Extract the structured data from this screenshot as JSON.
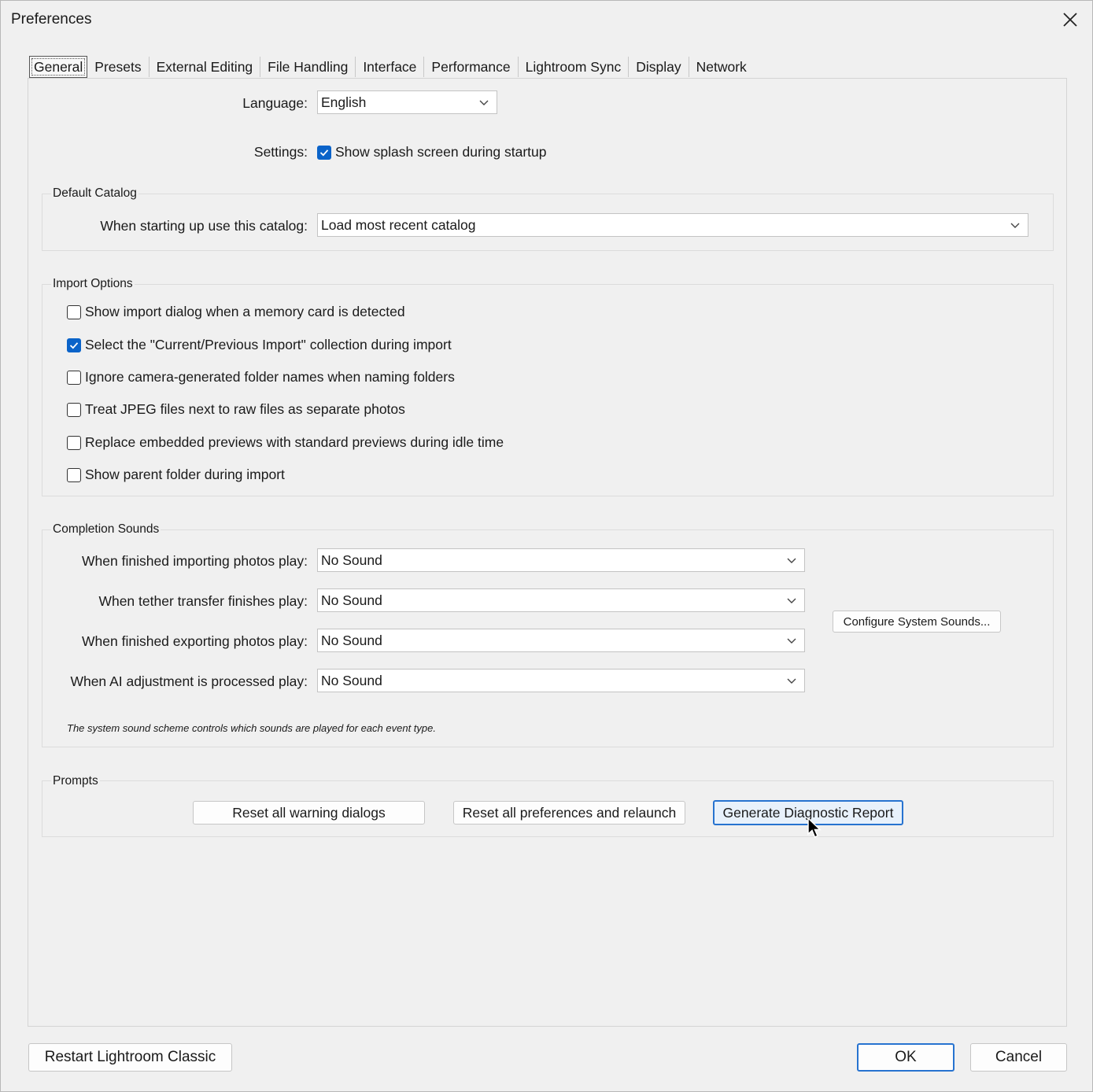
{
  "window": {
    "title": "Preferences"
  },
  "tabs": [
    {
      "label": "General",
      "active": true
    },
    {
      "label": "Presets"
    },
    {
      "label": "External Editing"
    },
    {
      "label": "File Handling"
    },
    {
      "label": "Interface"
    },
    {
      "label": "Performance"
    },
    {
      "label": "Lightroom Sync"
    },
    {
      "label": "Display"
    },
    {
      "label": "Network"
    }
  ],
  "general": {
    "language_label": "Language:",
    "language_value": "English",
    "settings_label": "Settings:",
    "splash": {
      "label": "Show splash screen during startup",
      "checked": true
    }
  },
  "default_catalog": {
    "title": "Default Catalog",
    "label": "When starting up use this catalog:",
    "value": "Load most recent catalog"
  },
  "import_options": {
    "title": "Import Options",
    "items": [
      {
        "label": "Show import dialog when a memory card is detected",
        "checked": false
      },
      {
        "label": "Select the \"Current/Previous Import\" collection during import",
        "checked": true
      },
      {
        "label": "Ignore camera-generated folder names when naming folders",
        "checked": false
      },
      {
        "label": "Treat JPEG files next to raw files as separate photos",
        "checked": false
      },
      {
        "label": "Replace embedded previews with standard previews during idle time",
        "checked": false
      },
      {
        "label": "Show parent folder during import",
        "checked": false
      }
    ]
  },
  "completion_sounds": {
    "title": "Completion Sounds",
    "rows": [
      {
        "label": "When finished importing photos play:",
        "value": "No Sound"
      },
      {
        "label": "When tether transfer finishes play:",
        "value": "No Sound"
      },
      {
        "label": "When finished exporting photos play:",
        "value": "No Sound"
      },
      {
        "label": "When AI adjustment is processed play:",
        "value": "No Sound"
      }
    ],
    "configure_button": "Configure System Sounds...",
    "note": "The system sound scheme controls which sounds are played for each event type."
  },
  "prompts": {
    "title": "Prompts",
    "reset_warnings": "Reset all warning dialogs",
    "reset_prefs": "Reset all preferences and relaunch",
    "diagnostic": "Generate Diagnostic Report"
  },
  "footer": {
    "restart": "Restart Lightroom Classic",
    "ok": "OK",
    "cancel": "Cancel"
  },
  "icons": {
    "close": "close-icon",
    "dropdown": "chevron-down-icon",
    "check": "checkmark-icon",
    "cursor": "mouse-pointer-icon"
  }
}
